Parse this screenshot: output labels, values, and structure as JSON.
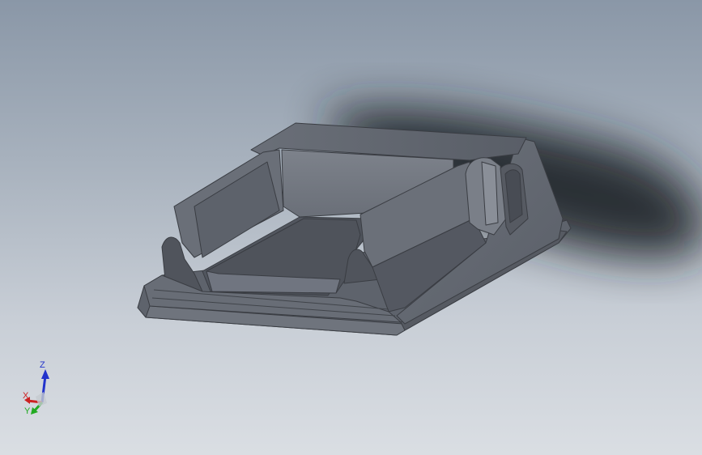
{
  "viewport": {
    "background_top": "#8a97a7",
    "background_bottom": "#dadee3",
    "model_color": "#5c6068",
    "shadow_color": "#1e2228"
  },
  "triad": {
    "axes": [
      {
        "label": "Z",
        "color": "#2233cc"
      },
      {
        "label": "X",
        "color": "#cc2222"
      },
      {
        "label": "Y",
        "color": "#22aa22"
      }
    ]
  }
}
